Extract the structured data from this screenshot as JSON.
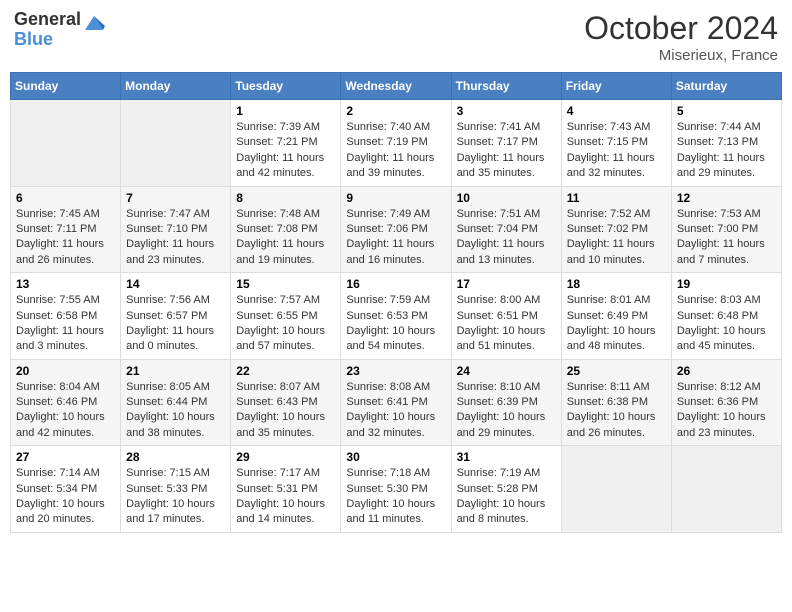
{
  "header": {
    "logo_general": "General",
    "logo_blue": "Blue",
    "month_title": "October 2024",
    "location": "Miserieux, France"
  },
  "weekdays": [
    "Sunday",
    "Monday",
    "Tuesday",
    "Wednesday",
    "Thursday",
    "Friday",
    "Saturday"
  ],
  "weeks": [
    [
      {
        "day": null
      },
      {
        "day": null
      },
      {
        "day": "1",
        "sunrise": "7:39 AM",
        "sunset": "7:21 PM",
        "daylight": "11 hours and 42 minutes."
      },
      {
        "day": "2",
        "sunrise": "7:40 AM",
        "sunset": "7:19 PM",
        "daylight": "11 hours and 39 minutes."
      },
      {
        "day": "3",
        "sunrise": "7:41 AM",
        "sunset": "7:17 PM",
        "daylight": "11 hours and 35 minutes."
      },
      {
        "day": "4",
        "sunrise": "7:43 AM",
        "sunset": "7:15 PM",
        "daylight": "11 hours and 32 minutes."
      },
      {
        "day": "5",
        "sunrise": "7:44 AM",
        "sunset": "7:13 PM",
        "daylight": "11 hours and 29 minutes."
      }
    ],
    [
      {
        "day": "6",
        "sunrise": "7:45 AM",
        "sunset": "7:11 PM",
        "daylight": "11 hours and 26 minutes."
      },
      {
        "day": "7",
        "sunrise": "7:47 AM",
        "sunset": "7:10 PM",
        "daylight": "11 hours and 23 minutes."
      },
      {
        "day": "8",
        "sunrise": "7:48 AM",
        "sunset": "7:08 PM",
        "daylight": "11 hours and 19 minutes."
      },
      {
        "day": "9",
        "sunrise": "7:49 AM",
        "sunset": "7:06 PM",
        "daylight": "11 hours and 16 minutes."
      },
      {
        "day": "10",
        "sunrise": "7:51 AM",
        "sunset": "7:04 PM",
        "daylight": "11 hours and 13 minutes."
      },
      {
        "day": "11",
        "sunrise": "7:52 AM",
        "sunset": "7:02 PM",
        "daylight": "11 hours and 10 minutes."
      },
      {
        "day": "12",
        "sunrise": "7:53 AM",
        "sunset": "7:00 PM",
        "daylight": "11 hours and 7 minutes."
      }
    ],
    [
      {
        "day": "13",
        "sunrise": "7:55 AM",
        "sunset": "6:58 PM",
        "daylight": "11 hours and 3 minutes."
      },
      {
        "day": "14",
        "sunrise": "7:56 AM",
        "sunset": "6:57 PM",
        "daylight": "11 hours and 0 minutes."
      },
      {
        "day": "15",
        "sunrise": "7:57 AM",
        "sunset": "6:55 PM",
        "daylight": "10 hours and 57 minutes."
      },
      {
        "day": "16",
        "sunrise": "7:59 AM",
        "sunset": "6:53 PM",
        "daylight": "10 hours and 54 minutes."
      },
      {
        "day": "17",
        "sunrise": "8:00 AM",
        "sunset": "6:51 PM",
        "daylight": "10 hours and 51 minutes."
      },
      {
        "day": "18",
        "sunrise": "8:01 AM",
        "sunset": "6:49 PM",
        "daylight": "10 hours and 48 minutes."
      },
      {
        "day": "19",
        "sunrise": "8:03 AM",
        "sunset": "6:48 PM",
        "daylight": "10 hours and 45 minutes."
      }
    ],
    [
      {
        "day": "20",
        "sunrise": "8:04 AM",
        "sunset": "6:46 PM",
        "daylight": "10 hours and 42 minutes."
      },
      {
        "day": "21",
        "sunrise": "8:05 AM",
        "sunset": "6:44 PM",
        "daylight": "10 hours and 38 minutes."
      },
      {
        "day": "22",
        "sunrise": "8:07 AM",
        "sunset": "6:43 PM",
        "daylight": "10 hours and 35 minutes."
      },
      {
        "day": "23",
        "sunrise": "8:08 AM",
        "sunset": "6:41 PM",
        "daylight": "10 hours and 32 minutes."
      },
      {
        "day": "24",
        "sunrise": "8:10 AM",
        "sunset": "6:39 PM",
        "daylight": "10 hours and 29 minutes."
      },
      {
        "day": "25",
        "sunrise": "8:11 AM",
        "sunset": "6:38 PM",
        "daylight": "10 hours and 26 minutes."
      },
      {
        "day": "26",
        "sunrise": "8:12 AM",
        "sunset": "6:36 PM",
        "daylight": "10 hours and 23 minutes."
      }
    ],
    [
      {
        "day": "27",
        "sunrise": "7:14 AM",
        "sunset": "5:34 PM",
        "daylight": "10 hours and 20 minutes."
      },
      {
        "day": "28",
        "sunrise": "7:15 AM",
        "sunset": "5:33 PM",
        "daylight": "10 hours and 17 minutes."
      },
      {
        "day": "29",
        "sunrise": "7:17 AM",
        "sunset": "5:31 PM",
        "daylight": "10 hours and 14 minutes."
      },
      {
        "day": "30",
        "sunrise": "7:18 AM",
        "sunset": "5:30 PM",
        "daylight": "10 hours and 11 minutes."
      },
      {
        "day": "31",
        "sunrise": "7:19 AM",
        "sunset": "5:28 PM",
        "daylight": "10 hours and 8 minutes."
      },
      {
        "day": null
      },
      {
        "day": null
      }
    ]
  ],
  "labels": {
    "sunrise_prefix": "Sunrise: ",
    "sunset_prefix": "Sunset: ",
    "daylight_prefix": "Daylight: "
  }
}
